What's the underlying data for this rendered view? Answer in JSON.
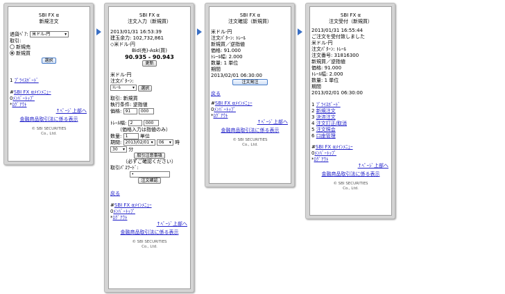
{
  "colors": {
    "link": "#1c1cc8",
    "arrow": "#3a6fc4",
    "frame": "#d4d4d4"
  },
  "common": {
    "menu_link": "SBI FX αﾒｲﾝﾒﾆｭｰ",
    "member_top": "ﾒﾝﾊﾞｰﾄｯﾌﾟ",
    "logout": "ﾛｸﾞｱｳﾄ",
    "page_top": "↑ﾍﾟｰｼﾞ上部へ",
    "disclosure": "金融商品取引法に係る表示",
    "copyright_1": "© SBI SECURITIES",
    "copyright_2": "Co., Ltd.",
    "back": "戻る",
    "prefix_hash": "#",
    "prefix_0": "0",
    "prefix_star": "*"
  },
  "p1": {
    "title_1": "SBI FX α",
    "title_2": "新規注文",
    "pair_label": "通貨ﾍﾟｱ:",
    "pair_value": "米ドル-円",
    "trade_label": "取引:",
    "opt_sell": "新規売",
    "opt_buy": "新規買",
    "select_btn": "選択",
    "price_board_num": "1",
    "price_board": "ﾌﾟﾗｲｽﾎﾞｰﾄﾞ"
  },
  "p2": {
    "title_1": "SBI FX α",
    "title_2": "注文入力（新規買）",
    "datetime": "2013/01/31 16:53:39",
    "margin_avail": "建玉余力: 102,732,861",
    "pair": "◇米ドル-円",
    "bidask_label": "Bid(売)-Ask(買)",
    "bidask_value": "90.935 - 90.943",
    "update_btn": "更新",
    "pair2": "米ドル-円",
    "pattern_label": "注文ﾊﾟﾀｰﾝ:",
    "pattern_value": "ﾄﾚｰﾙ",
    "select_btn": "選択",
    "trade": "取引: 新規買",
    "exec_cond": "執行条件: 逆指値",
    "price_label": "価格:",
    "price_int": "91",
    "price_dec": "000",
    "trail_label": "ﾄﾚｰﾙ幅:",
    "trail_int": "2",
    "trail_dec": "000",
    "price_note": "（価格入力は指値のみ）",
    "qty_label": "数量:",
    "qty_value": "1",
    "qty_unit": "単位",
    "period_label": "期間:",
    "period_date": "2013/02/01",
    "period_hour": "06",
    "hour_unit": "時",
    "period_min": "30",
    "min_unit": "分",
    "notice_btn": "取引注意事項",
    "notice_text": "（必ずご確認ください）",
    "pw_label": "取引ﾊﾟｽﾜｰﾄﾞ:",
    "pw_value": "•",
    "confirm_btn": "注文確認"
  },
  "p3": {
    "title_1": "SBI FX α",
    "title_2": "注文確認（新規買）",
    "pair": "米ドル-円",
    "pattern": "注文ﾊﾟﾀｰﾝ: ﾄﾚｰﾙ",
    "trade": "新規買／逆指値",
    "price": "価格: 91.000",
    "trail": "ﾄﾚｰﾙ幅: 2.000",
    "qty": "数量: 1 単位",
    "period_label": "期間",
    "period_value": "2013/02/01 06:30:00",
    "order_btn": "注文発注"
  },
  "p4": {
    "title_1": "SBI FX α",
    "title_2": "注文受付（新規買）",
    "datetime": "2013/01/31 16:55:44",
    "accepted": "ご注文を受付致しました",
    "pair": "米ドル-円",
    "pattern": "注文ﾊﾟﾀｰﾝ: ﾄﾚｰﾙ",
    "order_no": "注文番号: 31816300",
    "trade": "新規買／逆指値",
    "price": "価格: 91.000",
    "trail": "ﾄﾚｰﾙ幅: 2.000",
    "qty": "数量: 1 単位",
    "period_label": "期間",
    "period_value": "2013/02/01 06:30:00",
    "menu": [
      {
        "num": "1",
        "label": "ﾌﾟﾗｲｽﾎﾞｰﾄﾞ"
      },
      {
        "num": "2",
        "label": "新規注文"
      },
      {
        "num": "3",
        "label": "決済注文"
      },
      {
        "num": "4",
        "label": "注文訂正/取消"
      },
      {
        "num": "5",
        "label": "注文照会"
      },
      {
        "num": "6",
        "label": "口座管理"
      }
    ]
  }
}
